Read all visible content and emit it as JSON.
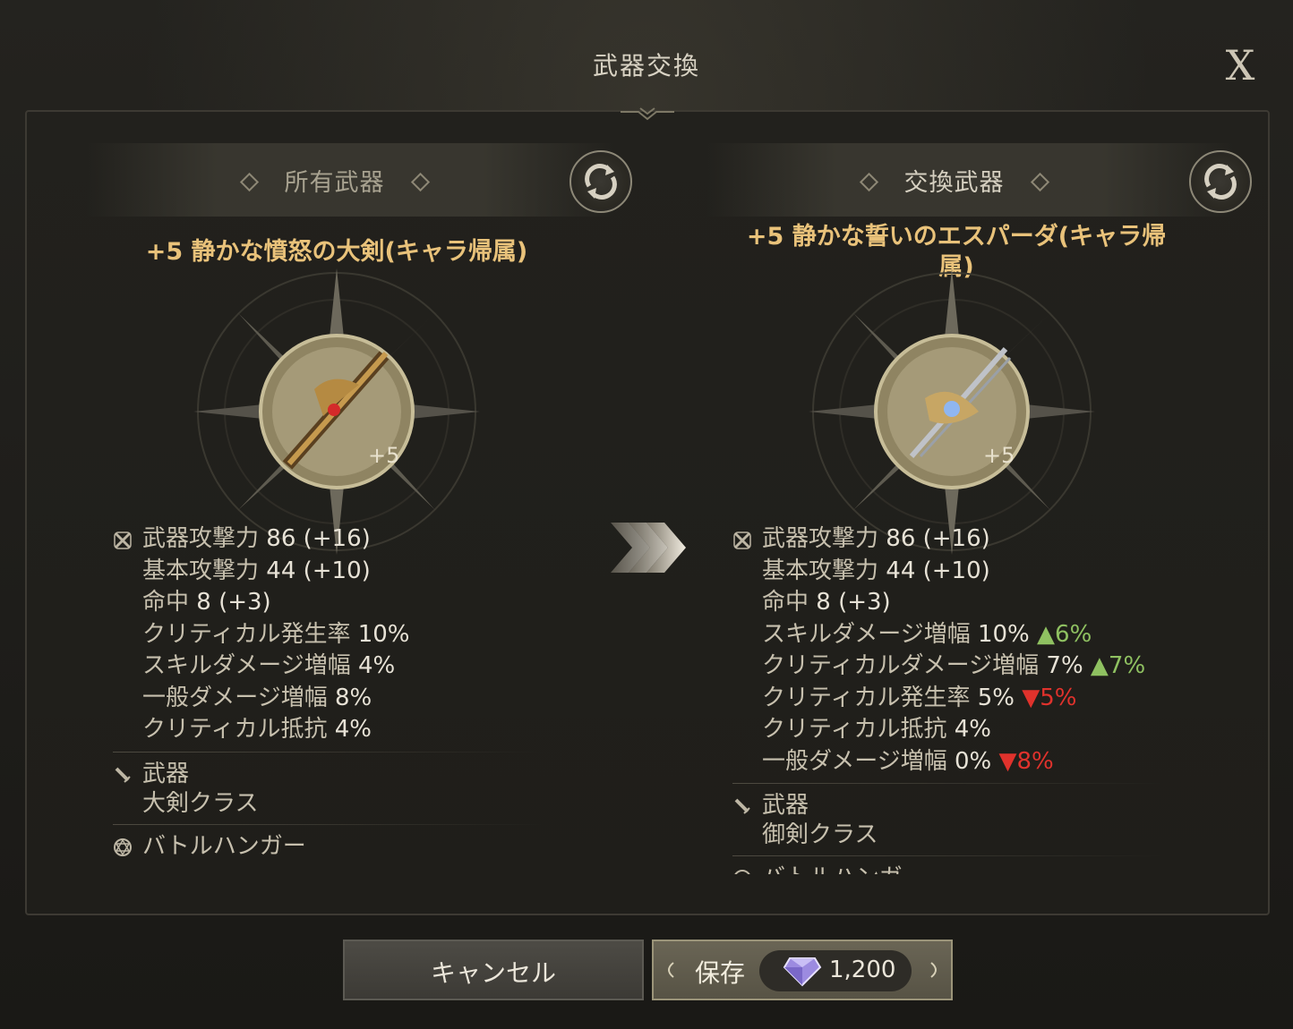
{
  "dialog": {
    "title": "武器交換",
    "close_label": "X"
  },
  "left_panel": {
    "header": "所有武器",
    "weapon_name": "+5 静かな憤怒の大剣(キャラ帰属)",
    "enhance_badge": "+5",
    "stats": [
      {
        "label": "武器攻撃力",
        "value": "86 (+16)"
      },
      {
        "label": "基本攻撃力",
        "value": "44 (+10)"
      },
      {
        "label": "命中",
        "value": "8 (+3)"
      },
      {
        "label": "クリティカル発生率",
        "value": "10%"
      },
      {
        "label": "スキルダメージ増幅",
        "value": "4%"
      },
      {
        "label": "一般ダメージ増幅",
        "value": "8%"
      },
      {
        "label": "クリティカル抵抗",
        "value": "4%"
      }
    ],
    "category_label": "武器",
    "class_label": "大剣クラス",
    "battle_label": "バトルハンガー"
  },
  "right_panel": {
    "header": "交換武器",
    "weapon_name_line1": "+5 静かな誓いのエスパーダ(キャラ帰",
    "weapon_name_line2": "属)",
    "enhance_badge": "+5",
    "stats": [
      {
        "label": "武器攻撃力",
        "value": "86 (+16)",
        "diff": ""
      },
      {
        "label": "基本攻撃力",
        "value": "44 (+10)",
        "diff": ""
      },
      {
        "label": "命中",
        "value": "8 (+3)",
        "diff": ""
      },
      {
        "label": "スキルダメージ増幅",
        "value": "10%",
        "diff": "▲6%"
      },
      {
        "label": "クリティカルダメージ増幅",
        "value": "7%",
        "diff": "▲7%"
      },
      {
        "label": "クリティカル発生率",
        "value": "5%",
        "diff": "▼5%"
      },
      {
        "label": "クリティカル抵抗",
        "value": "4%",
        "diff": ""
      },
      {
        "label": "一般ダメージ増幅",
        "value": "0%",
        "diff": "▼8%"
      }
    ],
    "category_label": "武器",
    "class_label": "御剣クラス",
    "battle_label_partial": "バトルハンガ"
  },
  "footer": {
    "cancel_label": "キャンセル",
    "save_label": "保存",
    "cost": "1,200"
  },
  "colors": {
    "gold_text": "#e9c27a",
    "up": "#8fc161",
    "down": "#e0322c"
  }
}
